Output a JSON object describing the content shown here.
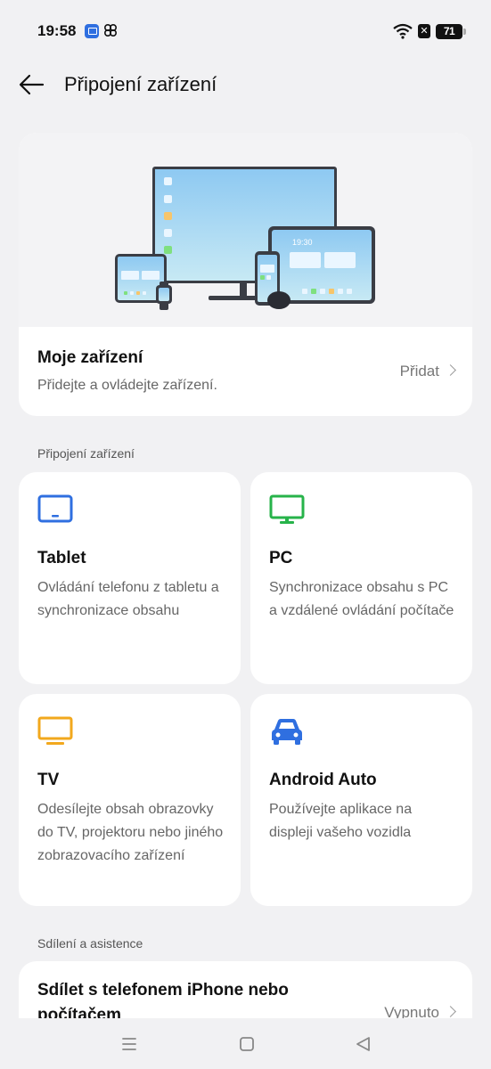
{
  "status_bar": {
    "time": "19:58",
    "icons": [
      "notification-app-icon",
      "pinwheel-app-icon",
      "wifi-icon",
      "sim-off-icon"
    ],
    "x_label": "✕",
    "battery": "71"
  },
  "header": {
    "title": "Připojení zařízení",
    "back_icon": "arrow-left-icon"
  },
  "hero": {
    "illustration_clock": "19:30",
    "title": "Moje zařízení",
    "subtitle": "Přidejte a ovládejte zařízení.",
    "action": "Přidat"
  },
  "connect_section": {
    "label": "Připojení zařízení",
    "tiles": [
      {
        "icon": "tablet-icon",
        "color": "#2f6fe0",
        "title": "Tablet",
        "desc": "Ovládání telefonu z tabletu a synchronizace obsahu"
      },
      {
        "icon": "pc-monitor-icon",
        "color": "#27b34a",
        "title": "PC",
        "desc": "Synchronizace obsahu s PC a vzdálené ovládání počítače"
      },
      {
        "icon": "tv-icon",
        "color": "#f2a81d",
        "title": "TV",
        "desc": "Odesílejte obsah obrazovky do TV, projektoru nebo jiného zobrazovacího zařízení"
      },
      {
        "icon": "car-icon",
        "color": "#2f6fe0",
        "title": "Android Auto",
        "desc": "Používejte aplikace na displeji vašeho vozidla"
      }
    ]
  },
  "share_section": {
    "label": "Sdílení a asistence",
    "item_title": "Sdílet s telefonem iPhone nebo počítačem",
    "item_state": "Vypnuto"
  },
  "nav_bar": {
    "buttons": [
      "menu-icon",
      "home-icon",
      "back-triangle-icon"
    ]
  }
}
